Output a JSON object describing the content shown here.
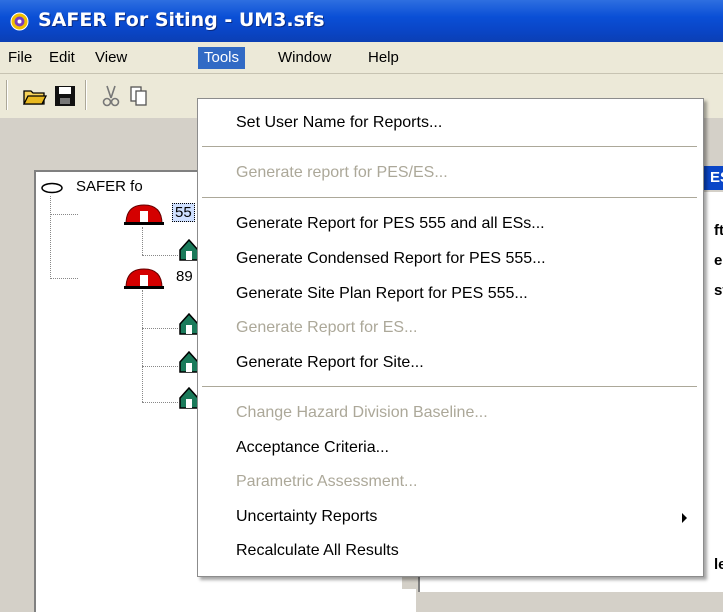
{
  "window": {
    "title": "SAFER For Siting - UM3.sfs"
  },
  "menubar": {
    "items": [
      {
        "label": "File"
      },
      {
        "label": "Edit"
      },
      {
        "label": "View"
      },
      {
        "label": "Tools"
      },
      {
        "label": "Window"
      },
      {
        "label": "Help"
      }
    ]
  },
  "toolbar": {
    "icons": [
      "open-folder-icon",
      "save-icon",
      "cut-icon",
      "copy-icon"
    ]
  },
  "tree": {
    "root_label": "SAFER fo",
    "node1_label": "55",
    "node2_label": "89"
  },
  "right_pane": {
    "title": "ES",
    "line1": "ft",
    "line2": "e:",
    "line3": "sta",
    "bottom": "le"
  },
  "tools_menu": {
    "items": [
      {
        "label": "Set User Name for Reports...",
        "enabled": true
      },
      {
        "label": "Generate report for PES/ES...",
        "enabled": false
      },
      {
        "label": "Generate Report for PES 555 and all ESs...",
        "enabled": true
      },
      {
        "label": "Generate Condensed Report for PES 555...",
        "enabled": true
      },
      {
        "label": "Generate Site Plan Report for PES 555...",
        "enabled": true
      },
      {
        "label": "Generate Report for ES...",
        "enabled": false
      },
      {
        "label": "Generate Report for Site...",
        "enabled": true
      },
      {
        "label": "Change Hazard Division Baseline...",
        "enabled": false
      },
      {
        "label": "Acceptance Criteria...",
        "enabled": true
      },
      {
        "label": "Parametric Assessment...",
        "enabled": false
      },
      {
        "label": "Uncertainty Reports",
        "enabled": true,
        "submenu": true
      },
      {
        "label": "Recalculate All Results",
        "enabled": true
      }
    ]
  },
  "colors": {
    "titlebar": "#0a46c8",
    "menu_highlight": "#316ac5",
    "disabled_text": "#aca899",
    "node_red": "#d40000"
  }
}
